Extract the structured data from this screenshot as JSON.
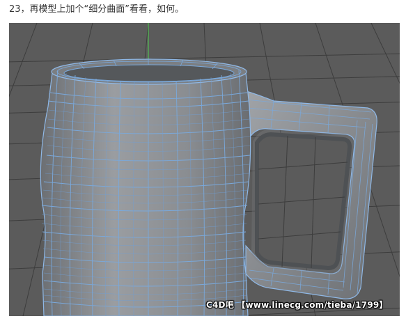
{
  "caption": "23，再模型上加个“细分曲面”看看，如何。",
  "viewport": {
    "watermark": "C4D吧 【www.linecg.com/tieba/1799】",
    "colors": {
      "background": "#5b5b5b",
      "grid": "#3f3f3f",
      "mesh_fill": "#8a8d90",
      "wireframe": "#6f9fd6",
      "axis_y": "#4fd24f"
    }
  }
}
